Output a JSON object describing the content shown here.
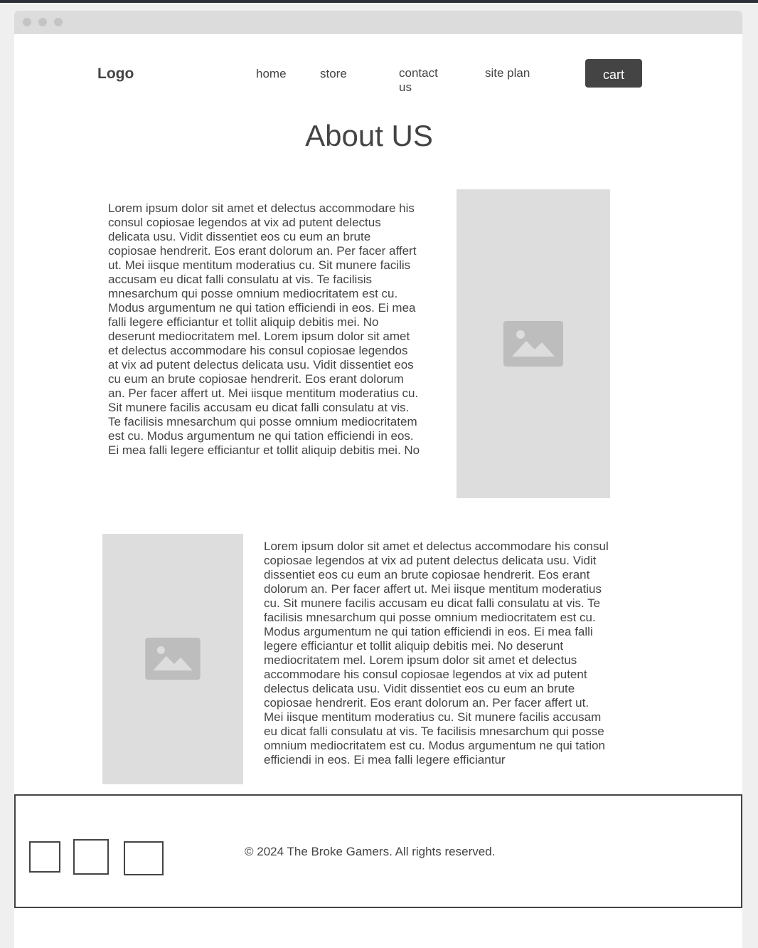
{
  "header": {
    "logo": "Logo",
    "nav": [
      "home",
      "store",
      "contact us",
      "site plan"
    ],
    "cart_label": "cart"
  },
  "main": {
    "title": "About US",
    "section1_text": "Lorem ipsum dolor sit amet et delectus accommodare his consul copiosae legendos at vix ad putent delectus delicata usu. Vidit dissentiet eos cu eum an brute copiosae hendrerit. Eos erant dolorum an. Per facer affert ut. Mei iisque mentitum moderatius cu. Sit munere facilis accusam eu dicat falli consulatu at vis. Te facilisis mnesarchum qui posse omnium mediocritatem est cu. Modus argumentum ne qui tation efficiendi in eos. Ei mea falli legere efficiantur et tollit aliquip debitis mei. No deserunt mediocritatem mel. Lorem ipsum dolor sit amet et delectus accommodare his consul copiosae legendos at vix ad putent delectus delicata usu. Vidit dissentiet eos cu eum an brute copiosae hendrerit. Eos erant dolorum an. Per facer affert ut. Mei iisque mentitum moderatius cu. Sit munere facilis accusam eu dicat falli consulatu at vis. Te facilisis mnesarchum qui posse omnium mediocritatem est cu. Modus argumentum ne qui tation efficiendi in eos. Ei mea falli legere efficiantur et tollit aliquip debitis mei. No",
    "section2_text": "Lorem ipsum dolor sit amet et delectus accommodare his consul copiosae legendos at vix ad putent delectus delicata usu. Vidit dissentiet eos cu eum an brute copiosae hendrerit. Eos erant dolorum an. Per facer affert ut. Mei iisque mentitum moderatius cu. Sit munere facilis accusam eu dicat falli consulatu at vis. Te facilisis mnesarchum qui posse omnium mediocritatem est cu. Modus argumentum ne qui tation efficiendi in eos. Ei mea falli legere efficiantur et tollit aliquip debitis mei. No deserunt mediocritatem mel. Lorem ipsum dolor sit amet et delectus accommodare his consul copiosae legendos at vix ad putent delectus delicata usu. Vidit dissentiet eos cu eum an brute copiosae hendrerit. Eos erant dolorum an. Per facer affert ut. Mei iisque mentitum moderatius cu. Sit munere facilis accusam eu dicat falli consulatu at vis. Te facilisis mnesarchum qui posse omnium mediocritatem est cu. Modus argumentum ne qui tation efficiendi in eos. Ei mea falli legere efficiantur"
  },
  "icons": {
    "image_placeholder": "image-placeholder-icon",
    "social": [
      "social-icon",
      "social-icon",
      "social-icon"
    ]
  },
  "footer": {
    "copyright": "© 2024 The Broke Gamers. All rights reserved."
  },
  "colors": {
    "text": "#444444",
    "button": "#444444",
    "placeholder": "#dddddd",
    "placeholder_icon": "#bdbdbd"
  }
}
